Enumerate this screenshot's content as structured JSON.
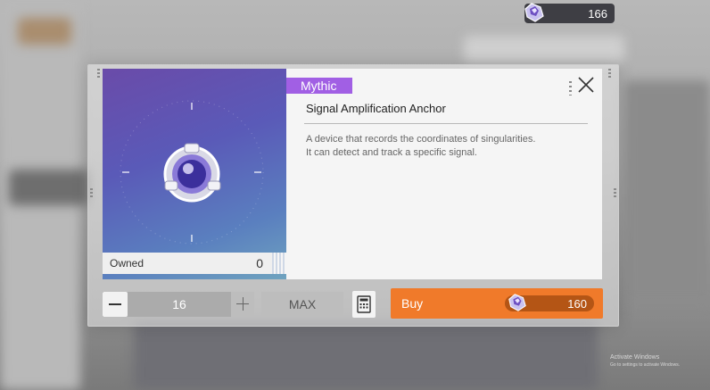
{
  "currency": {
    "amount": "166",
    "icon": "crystal-gem-icon",
    "color": "#3e3e44"
  },
  "item": {
    "rarity": "Mythic",
    "rarity_color": "#a15fe4",
    "name": "Signal Amplification Anchor",
    "description_lines": [
      "A device that records the coordinates of singularities.",
      "It can detect and track a specific signal."
    ],
    "owned_label": "Owned",
    "owned_count": "0"
  },
  "purchase": {
    "quantity": "16",
    "max_label": "MAX",
    "buy_label": "Buy",
    "price": "160",
    "buy_color": "#f07a2a"
  },
  "watermark": {
    "title": "Activate Windows",
    "subtitle": "Go to settings to activate Windows."
  }
}
